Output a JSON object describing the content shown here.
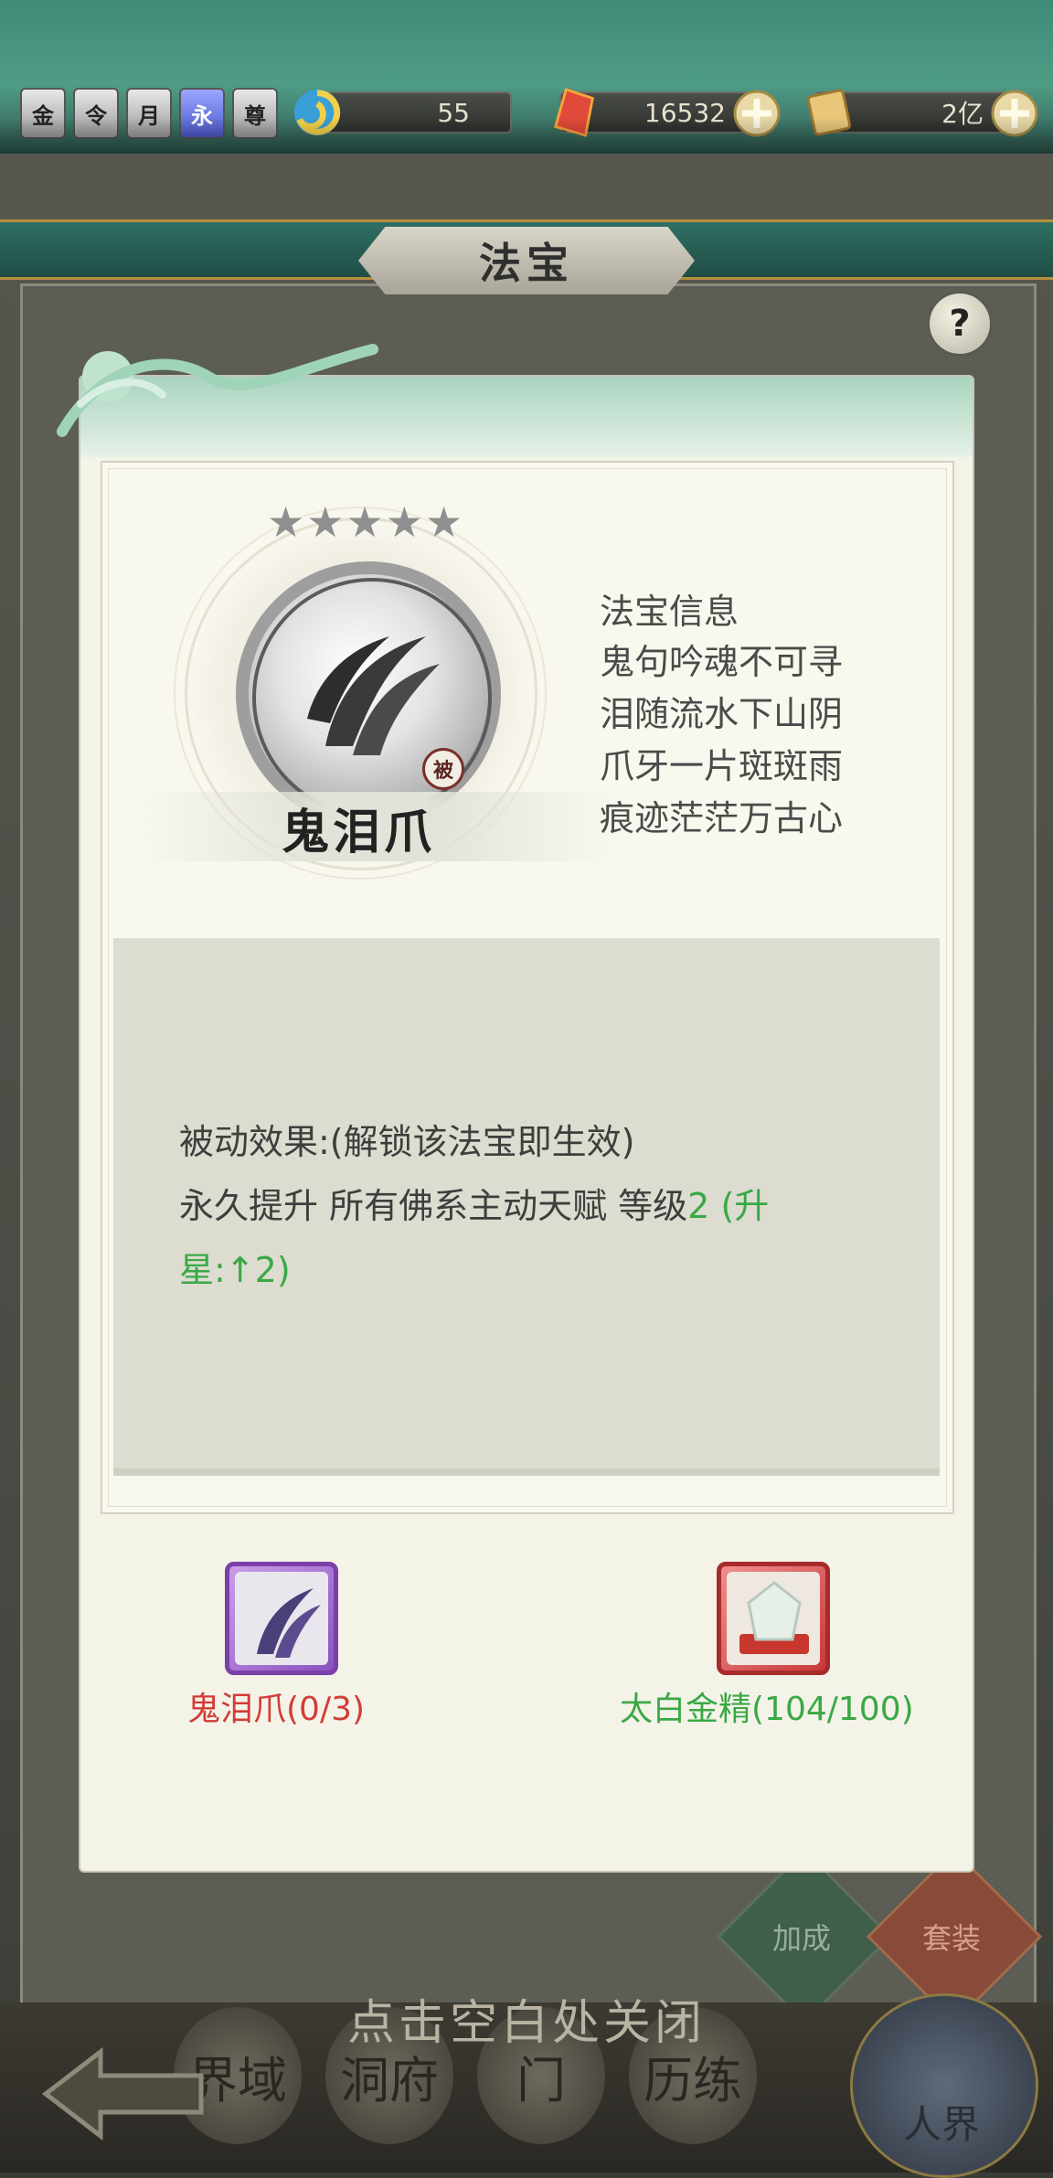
{
  "topbar": {
    "vip_badges": [
      "金",
      "令",
      "月",
      "永",
      "尊"
    ],
    "resources": [
      {
        "icon": "swirl-coin-icon",
        "value": "55"
      },
      {
        "icon": "red-crystal-icon",
        "value": "16532"
      },
      {
        "icon": "scroll-icon",
        "value": "2亿"
      }
    ]
  },
  "panel": {
    "title": "法宝",
    "help_label": "?"
  },
  "modal": {
    "star_count": 5,
    "item_name": "鬼泪爪",
    "passive_badge": "被",
    "info_title": "法宝信息",
    "poem_lines": [
      "鬼句吟魂不可寻",
      "泪随流水下山阴",
      "爪牙一片斑斑雨",
      "痕迹茫茫万古心"
    ],
    "effect": {
      "line1": "被动效果:(解锁该法宝即生效)",
      "line2_prefix": "永久提升 所有佛系主动天赋 等级",
      "level": "2",
      "upgrade_text": " (升星:↑2)"
    },
    "materials": [
      {
        "icon": "claw-shard-icon",
        "label": "鬼泪爪(0/3)",
        "color": "#d23c37"
      },
      {
        "icon": "white-gold-essence-icon",
        "label": "太白金精(104/100)",
        "color": "#3aa845"
      }
    ]
  },
  "side_buttons": {
    "bonus": "加成",
    "set": "套装"
  },
  "close_hint": "点击空白处关闭",
  "bottom_nav": {
    "tabs": [
      "界域",
      "洞府",
      "门",
      "历练"
    ],
    "realm": "人界"
  }
}
